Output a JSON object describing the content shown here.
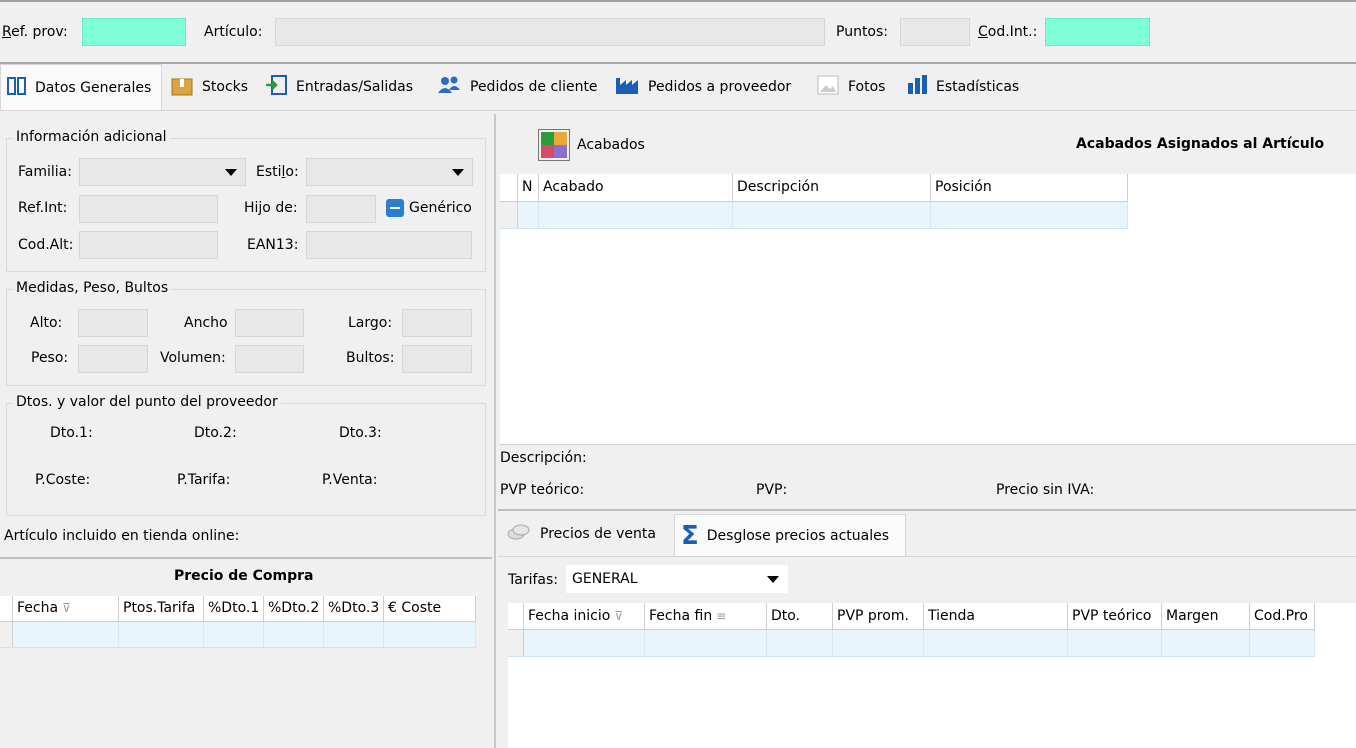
{
  "topbar": {
    "ref_prov_label": "Ref. prov:",
    "articulo_label": "Artículo:",
    "puntos_label": "Puntos:",
    "codint_label": "Cod.Int.:"
  },
  "tabs": [
    {
      "label": "Datos Generales",
      "icon": "columns-icon"
    },
    {
      "label": "Stocks",
      "icon": "box-icon"
    },
    {
      "label": "Entradas/Salidas",
      "icon": "exchange-icon"
    },
    {
      "label": "Pedidos de cliente",
      "icon": "users-icon"
    },
    {
      "label": "Pedidos a proveedor",
      "icon": "factory-icon"
    },
    {
      "label": "Fotos",
      "icon": "picture-icon"
    },
    {
      "label": "Estadísticas",
      "icon": "bar-chart-icon"
    }
  ],
  "info": {
    "title": "Información adicional",
    "familia_label": "Familia:",
    "estilo_label": "Estilo:",
    "refint_label": "Ref.Int:",
    "hijode_label": "Hijo de:",
    "generico_label": "Genérico",
    "codalt_label": "Cod.Alt:",
    "ean13_label": "EAN13:"
  },
  "medidas": {
    "title": "Medidas, Peso, Bultos",
    "alto_label": "Alto:",
    "ancho_label": "Ancho",
    "largo_label": "Largo:",
    "peso_label": "Peso:",
    "volumen_label": "Volumen:",
    "bultos_label": "Bultos:"
  },
  "dtos": {
    "title": "Dtos. y valor del punto del proveedor",
    "dto1_label": "Dto.1:",
    "dto2_label": "Dto.2:",
    "dto3_label": "Dto.3:",
    "pcoste_label": "P.Coste:",
    "ptarifa_label": "P.Tarifa:",
    "pventa_label": "P.Venta:"
  },
  "online_label": "Artículo incluido en tienda online:",
  "compra": {
    "title": "Precio de Compra",
    "columns": [
      "Fecha",
      "Ptos.Tarifa",
      "%Dto.1",
      "%Dto.2",
      "%Dto.3",
      "€ Coste"
    ]
  },
  "acabados": {
    "button_label": "Acabados",
    "title": "Acabados Asignados al Artículo",
    "columns": [
      "N",
      "Acabado",
      "Descripción",
      "Posición"
    ]
  },
  "detalle": {
    "descripcion_label": "Descripción:",
    "pvp_teorico_label": "PVP teórico:",
    "pvp_label": "PVP:",
    "precio_sin_iva_label": "Precio sin IVA:"
  },
  "precios_tabs": [
    "Precios de venta",
    "Desglose precios actuales"
  ],
  "tarifas": {
    "label": "Tarifas:",
    "value": "GENERAL"
  },
  "precios_grid": {
    "columns": [
      "Fecha inicio",
      "Fecha fin",
      "Dto.",
      "PVP prom.",
      "Tienda",
      "PVP teórico",
      "Margen",
      "Cod.Pro"
    ]
  }
}
